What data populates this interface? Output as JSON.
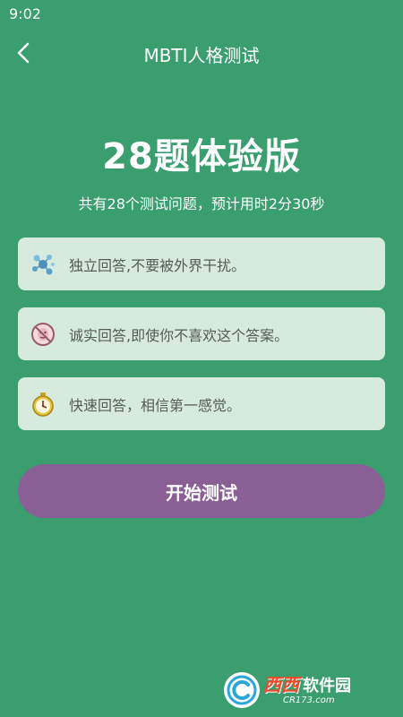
{
  "status_bar": {
    "time": "9:02"
  },
  "nav": {
    "title": "MBTI人格测试",
    "back_icon": "chevron-left-icon"
  },
  "hero": {
    "title": "28题体验版",
    "subtitle": "共有28个测试问题，预计用时2分30秒"
  },
  "tips": [
    {
      "icon": "molecule-icon",
      "text": "独立回答,不要被外界干扰。"
    },
    {
      "icon": "no-mask-icon",
      "text": "诚实回答,即使你不喜欢这个答案。"
    },
    {
      "icon": "stopwatch-icon",
      "text": "快速回答，相信第一感觉。"
    }
  ],
  "start_button": {
    "label": "开始测试"
  },
  "watermark": {
    "brand": "西西",
    "suffix": "软件园",
    "url": "CR173.com"
  },
  "colors": {
    "background": "#3a9e6f",
    "card": "#d6eade",
    "button": "#8a5f96",
    "card_text": "#555b57"
  }
}
